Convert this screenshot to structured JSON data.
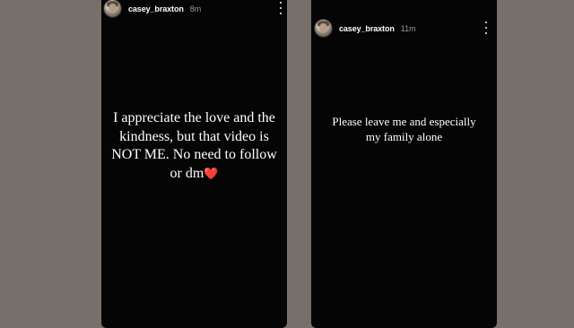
{
  "stories": [
    {
      "username": "casey_braxton",
      "timestamp": "8m",
      "caption": "I appreciate the love and the kindness, but that video is NOT ME. No need to follow or dm",
      "emoji": "❤️"
    },
    {
      "username": "casey_braxton",
      "timestamp": "11m",
      "caption": "Please leave me and especially my family alone"
    }
  ],
  "icons": {
    "menu": "more-options-icon",
    "heart": "red-heart-emoji"
  },
  "colors": {
    "page_background": "#776f69",
    "story_background": "#050505",
    "text": "#ffffff",
    "timestamp": "#9a9a9a",
    "heart": "#ef3b46"
  }
}
